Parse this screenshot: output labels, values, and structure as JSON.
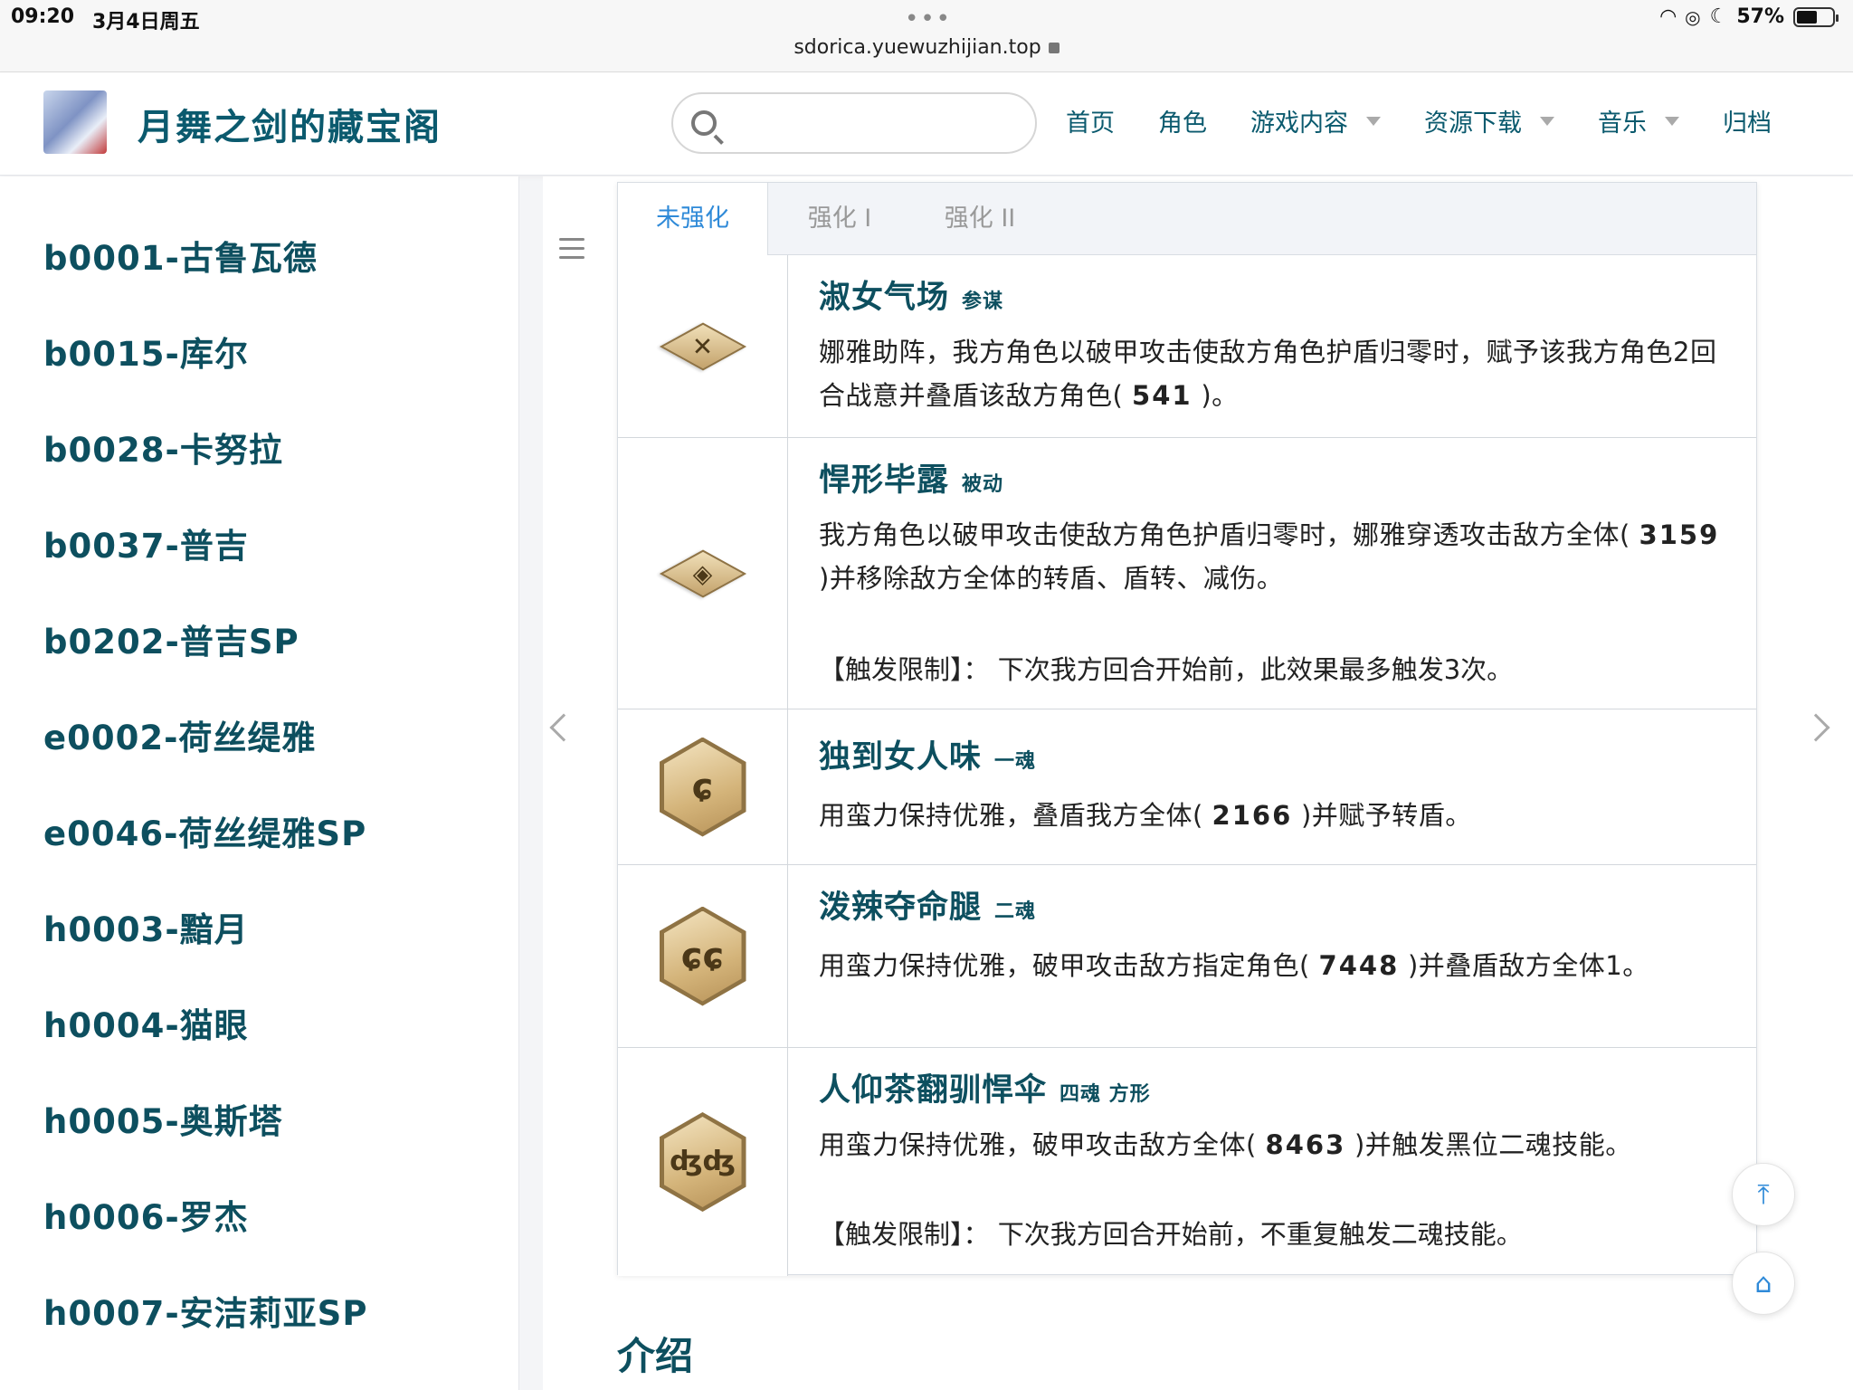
{
  "status_bar": {
    "time": "09:20",
    "date": "3月4日周五",
    "dots": "•••",
    "url": "sdorica.yuewuzhijian.top",
    "battery": "57%",
    "battery_level": 0.57
  },
  "header": {
    "site_title": "月舞之剑的藏宝阁",
    "search_placeholder": "",
    "nav": [
      {
        "label": "首页",
        "has_dropdown": false
      },
      {
        "label": "角色",
        "has_dropdown": false
      },
      {
        "label": "游戏内容",
        "has_dropdown": true
      },
      {
        "label": "资源下载",
        "has_dropdown": true
      },
      {
        "label": "音乐",
        "has_dropdown": true
      },
      {
        "label": "归档",
        "has_dropdown": false
      }
    ]
  },
  "sidebar": {
    "items": [
      "b0001-古鲁瓦德",
      "b0015-库尔",
      "b0028-卡努拉",
      "b0037-普吉",
      "b0202-普吉SP",
      "e0002-荷丝缇雅",
      "e0046-荷丝缇雅SP",
      "h0003-黯月",
      "h0004-猫眼",
      "h0005-奥斯塔",
      "h0006-罗杰",
      "h0007-安洁莉亚SP"
    ]
  },
  "tabs": [
    "未强化",
    "强化 I",
    "强化 II"
  ],
  "skills": [
    {
      "name": "淑女气场",
      "tag": "参谋",
      "icon": "diamond-crossed-swords-icon",
      "desc_pre": "娜雅助阵，我方角色以破甲攻击使敌方角色护盾归零时，赋予该我方角色2回合战意并叠盾该敌方角色(",
      "value": "541",
      "desc_post": ")。",
      "limit": ""
    },
    {
      "name": "悍形毕露",
      "tag": "被动",
      "icon": "diamond-target-icon",
      "desc_pre": "我方角色以破甲攻击使敌方角色护盾归零时，娜雅穿透攻击敌方全体(",
      "value": "3159",
      "desc_post": ")并移除敌方全体的转盾、盾转、减伤。",
      "limit": "【触发限制】： 下次我方回合开始前，此效果最多触发3次。"
    },
    {
      "name": "独到女人味",
      "tag": "一魂",
      "icon": "hex-one-soul-icon",
      "desc_pre": "用蛮力保持优雅，叠盾我方全体(",
      "value": "2166",
      "desc_post": ")并赋予转盾。",
      "limit": ""
    },
    {
      "name": "泼辣夺命腿",
      "tag": "二魂",
      "icon": "hex-two-soul-icon",
      "desc_pre": "用蛮力保持优雅，破甲攻击敌方指定角色(",
      "value": "7448",
      "desc_post": ")并叠盾敌方全体1。",
      "limit": ""
    },
    {
      "name": "人仰茶翻驯悍伞",
      "tag": "四魂  方形",
      "icon": "hex-four-soul-icon",
      "desc_pre": "用蛮力保持优雅，破甲攻击敌方全体(",
      "value": "8463",
      "desc_post": ")并触发黑位二魂技能。",
      "limit": "【触发限制】： 下次我方回合开始前，不重复触发二魂技能。"
    }
  ],
  "section_title": "介绍",
  "colors": {
    "accent": "#2f8ad8",
    "title": "#0d4f5f",
    "icon_gold": "#c4a36c"
  }
}
